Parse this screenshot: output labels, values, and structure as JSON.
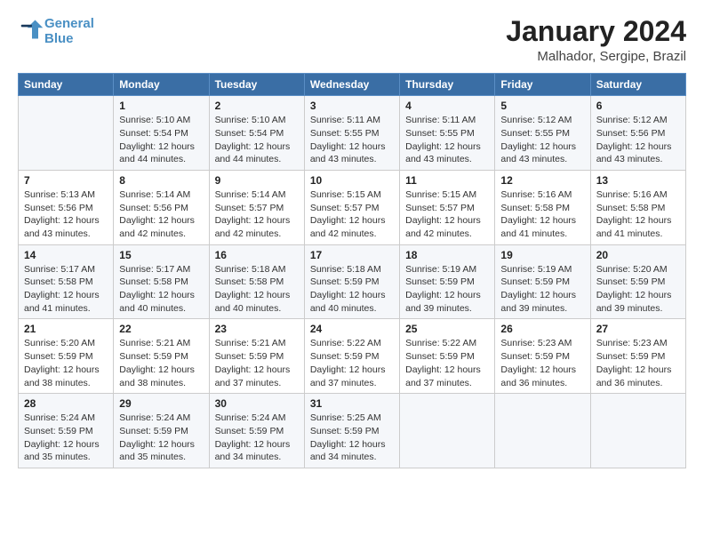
{
  "header": {
    "logo_line1": "General",
    "logo_line2": "Blue",
    "main_title": "January 2024",
    "subtitle": "Malhador, Sergipe, Brazil"
  },
  "weekdays": [
    "Sunday",
    "Monday",
    "Tuesday",
    "Wednesday",
    "Thursday",
    "Friday",
    "Saturday"
  ],
  "weeks": [
    [
      {
        "day": "",
        "info": ""
      },
      {
        "day": "1",
        "info": "Sunrise: 5:10 AM\nSunset: 5:54 PM\nDaylight: 12 hours\nand 44 minutes."
      },
      {
        "day": "2",
        "info": "Sunrise: 5:10 AM\nSunset: 5:54 PM\nDaylight: 12 hours\nand 44 minutes."
      },
      {
        "day": "3",
        "info": "Sunrise: 5:11 AM\nSunset: 5:55 PM\nDaylight: 12 hours\nand 43 minutes."
      },
      {
        "day": "4",
        "info": "Sunrise: 5:11 AM\nSunset: 5:55 PM\nDaylight: 12 hours\nand 43 minutes."
      },
      {
        "day": "5",
        "info": "Sunrise: 5:12 AM\nSunset: 5:55 PM\nDaylight: 12 hours\nand 43 minutes."
      },
      {
        "day": "6",
        "info": "Sunrise: 5:12 AM\nSunset: 5:56 PM\nDaylight: 12 hours\nand 43 minutes."
      }
    ],
    [
      {
        "day": "7",
        "info": "Sunrise: 5:13 AM\nSunset: 5:56 PM\nDaylight: 12 hours\nand 43 minutes."
      },
      {
        "day": "8",
        "info": "Sunrise: 5:14 AM\nSunset: 5:56 PM\nDaylight: 12 hours\nand 42 minutes."
      },
      {
        "day": "9",
        "info": "Sunrise: 5:14 AM\nSunset: 5:57 PM\nDaylight: 12 hours\nand 42 minutes."
      },
      {
        "day": "10",
        "info": "Sunrise: 5:15 AM\nSunset: 5:57 PM\nDaylight: 12 hours\nand 42 minutes."
      },
      {
        "day": "11",
        "info": "Sunrise: 5:15 AM\nSunset: 5:57 PM\nDaylight: 12 hours\nand 42 minutes."
      },
      {
        "day": "12",
        "info": "Sunrise: 5:16 AM\nSunset: 5:58 PM\nDaylight: 12 hours\nand 41 minutes."
      },
      {
        "day": "13",
        "info": "Sunrise: 5:16 AM\nSunset: 5:58 PM\nDaylight: 12 hours\nand 41 minutes."
      }
    ],
    [
      {
        "day": "14",
        "info": "Sunrise: 5:17 AM\nSunset: 5:58 PM\nDaylight: 12 hours\nand 41 minutes."
      },
      {
        "day": "15",
        "info": "Sunrise: 5:17 AM\nSunset: 5:58 PM\nDaylight: 12 hours\nand 40 minutes."
      },
      {
        "day": "16",
        "info": "Sunrise: 5:18 AM\nSunset: 5:58 PM\nDaylight: 12 hours\nand 40 minutes."
      },
      {
        "day": "17",
        "info": "Sunrise: 5:18 AM\nSunset: 5:59 PM\nDaylight: 12 hours\nand 40 minutes."
      },
      {
        "day": "18",
        "info": "Sunrise: 5:19 AM\nSunset: 5:59 PM\nDaylight: 12 hours\nand 39 minutes."
      },
      {
        "day": "19",
        "info": "Sunrise: 5:19 AM\nSunset: 5:59 PM\nDaylight: 12 hours\nand 39 minutes."
      },
      {
        "day": "20",
        "info": "Sunrise: 5:20 AM\nSunset: 5:59 PM\nDaylight: 12 hours\nand 39 minutes."
      }
    ],
    [
      {
        "day": "21",
        "info": "Sunrise: 5:20 AM\nSunset: 5:59 PM\nDaylight: 12 hours\nand 38 minutes."
      },
      {
        "day": "22",
        "info": "Sunrise: 5:21 AM\nSunset: 5:59 PM\nDaylight: 12 hours\nand 38 minutes."
      },
      {
        "day": "23",
        "info": "Sunrise: 5:21 AM\nSunset: 5:59 PM\nDaylight: 12 hours\nand 37 minutes."
      },
      {
        "day": "24",
        "info": "Sunrise: 5:22 AM\nSunset: 5:59 PM\nDaylight: 12 hours\nand 37 minutes."
      },
      {
        "day": "25",
        "info": "Sunrise: 5:22 AM\nSunset: 5:59 PM\nDaylight: 12 hours\nand 37 minutes."
      },
      {
        "day": "26",
        "info": "Sunrise: 5:23 AM\nSunset: 5:59 PM\nDaylight: 12 hours\nand 36 minutes."
      },
      {
        "day": "27",
        "info": "Sunrise: 5:23 AM\nSunset: 5:59 PM\nDaylight: 12 hours\nand 36 minutes."
      }
    ],
    [
      {
        "day": "28",
        "info": "Sunrise: 5:24 AM\nSunset: 5:59 PM\nDaylight: 12 hours\nand 35 minutes."
      },
      {
        "day": "29",
        "info": "Sunrise: 5:24 AM\nSunset: 5:59 PM\nDaylight: 12 hours\nand 35 minutes."
      },
      {
        "day": "30",
        "info": "Sunrise: 5:24 AM\nSunset: 5:59 PM\nDaylight: 12 hours\nand 34 minutes."
      },
      {
        "day": "31",
        "info": "Sunrise: 5:25 AM\nSunset: 5:59 PM\nDaylight: 12 hours\nand 34 minutes."
      },
      {
        "day": "",
        "info": ""
      },
      {
        "day": "",
        "info": ""
      },
      {
        "day": "",
        "info": ""
      }
    ]
  ]
}
